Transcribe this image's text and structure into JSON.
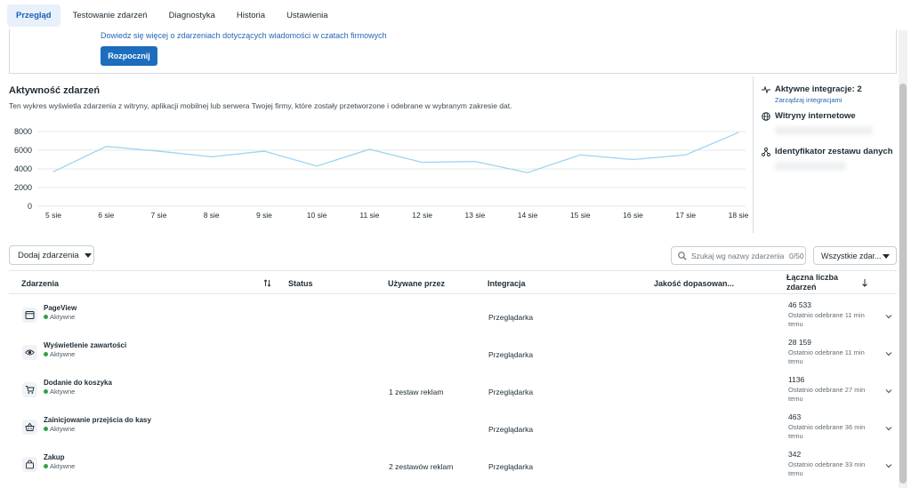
{
  "tabs": [
    {
      "label": "Przegląd",
      "active": true
    },
    {
      "label": "Testowanie zdarzeń",
      "active": false
    },
    {
      "label": "Diagnostyka",
      "active": false
    },
    {
      "label": "Historia",
      "active": false
    },
    {
      "label": "Ustawienia",
      "active": false
    }
  ],
  "banner": {
    "link": "Dowiedz się więcej o zdarzeniach dotyczących wiadomości w czatach firmowych",
    "button": "Rozpocznij"
  },
  "activity": {
    "title": "Aktywność zdarzeń",
    "description": "Ten wykres wyświetla zdarzenia z witryny, aplikacji mobilnej lub serwera Twojej firmy, które zostały przetworzone i odebrane w wybranym zakresie dat."
  },
  "chart_data": {
    "type": "line",
    "categories": [
      "5 sie",
      "6 sie",
      "7 sie",
      "8 sie",
      "9 sie",
      "10 sie",
      "11 sie",
      "12 sie",
      "13 sie",
      "14 sie",
      "15 sie",
      "16 sie",
      "17 sie",
      "18 sie"
    ],
    "values": [
      3700,
      6400,
      5900,
      5300,
      5900,
      4300,
      6100,
      4700,
      4800,
      3600,
      5500,
      5000,
      5500,
      7900
    ],
    "yticks": [
      "0",
      "2000",
      "4000",
      "6000",
      "8000"
    ],
    "ylim": [
      0,
      8000
    ],
    "grid": true,
    "line_color": "#9fd3f0"
  },
  "side": {
    "integrations": "Aktywne integracje: 2",
    "manage": "Zarządzaj integracjami",
    "websites": "Witryny internetowe",
    "dataset": "Identyfikator zestawu danych"
  },
  "toolbar": {
    "add_events": "Dodaj zdarzenia",
    "search_placeholder": "Szukaj wg nazwy zdarzenia",
    "search_count": "0/50",
    "filter": "Wszystkie zdar..."
  },
  "table": {
    "headers": {
      "events": "Zdarzenia",
      "status": "Status",
      "used_by": "Używane przez",
      "integration": "Integracja",
      "match": "Jakość dopasowan...",
      "total": "Łączna liczba zdarzeń"
    },
    "rows": [
      {
        "name": "PageView",
        "status": "Aktywne",
        "used_by": "",
        "integration": "Przeglądarka",
        "total": "46 533",
        "last": "Ostatnio odebrane 11 min temu",
        "icon": "browser-icon"
      },
      {
        "name": "Wyświetlenie zawartości",
        "status": "Aktywne",
        "used_by": "",
        "integration": "Przeglądarka",
        "total": "28 159",
        "last": "Ostatnio odebrane 11 min temu",
        "icon": "eye-icon"
      },
      {
        "name": "Dodanie do koszyka",
        "status": "Aktywne",
        "used_by": "1 zestaw reklam",
        "integration": "Przeglądarka",
        "total": "1136",
        "last": "Ostatnio odebrane 27 min temu",
        "icon": "cart-icon"
      },
      {
        "name": "Zainicjowanie przejścia do kasy",
        "status": "Aktywne",
        "used_by": "",
        "integration": "Przeglądarka",
        "total": "463",
        "last": "Ostatnio odebrane 36 min temu",
        "icon": "basket-icon"
      },
      {
        "name": "Zakup",
        "status": "Aktywne",
        "used_by": "2 zestawów reklam",
        "integration": "Przeglądarka",
        "total": "342",
        "last": "Ostatnio odebrane 33 min temu",
        "icon": "bag-icon"
      }
    ]
  }
}
